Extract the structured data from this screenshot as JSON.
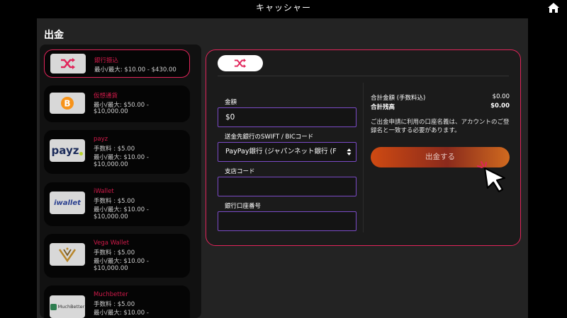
{
  "topbar": {
    "title": "キャッシャー"
  },
  "page": {
    "title": "出金"
  },
  "methods": [
    {
      "name": "銀行振込",
      "lines": [
        "最小/最大: $10.00 - $430.00"
      ],
      "icon": "shuffle-icon",
      "active": true
    },
    {
      "name": "仮想通貨",
      "lines": [
        "最小/最大: $50.00 -",
        "$10,000.00"
      ],
      "icon": "bitcoin-logo",
      "active": false
    },
    {
      "name": "payz",
      "lines": [
        "手数料 : $5.00",
        "最小/最大: $10.00 -",
        "$10,000.00"
      ],
      "logo_text": "payz",
      "active": false
    },
    {
      "name": "iWallet",
      "lines": [
        "手数料 : $5.00",
        "最小/最大: $10.00 -",
        "$10,000.00"
      ],
      "logo_text": "iwallet",
      "active": false
    },
    {
      "name": "Vega Wallet",
      "lines": [
        "手数料 : $5.00",
        "最小/最大: $10.00 -",
        "$10,000.00"
      ],
      "icon": "vega-logo",
      "active": false
    },
    {
      "name": "Muchbetter",
      "lines": [
        "手数料 : $5.00",
        "最小/最大: $10.00 -"
      ],
      "logo_text": "MuchBetter",
      "active": false
    }
  ],
  "form": {
    "amount_label": "金額",
    "amount_value": "$0",
    "swift_label": "送金先銀行のSWIFT / BICコード",
    "swift_value": "PayPay銀行 (ジャパンネット銀行 (F",
    "branch_label": "支店コード",
    "branch_value": "",
    "account_label": "銀行口座番号",
    "account_value": ""
  },
  "summary": {
    "total_label": "合計金額 (手数料込)",
    "total_value": "$0.00",
    "balance_label": "合計残高",
    "balance_value": "$0.00",
    "notice": "ご出金申請に利用の口座名義は、アカウントのご登録名と一致する必要があります。"
  },
  "button": {
    "withdraw_label": "出金する"
  },
  "colors": {
    "accent": "#e1245a",
    "field_border": "#7b4bc7",
    "button_start": "#cf4a12",
    "button_end": "#d06a1f"
  }
}
